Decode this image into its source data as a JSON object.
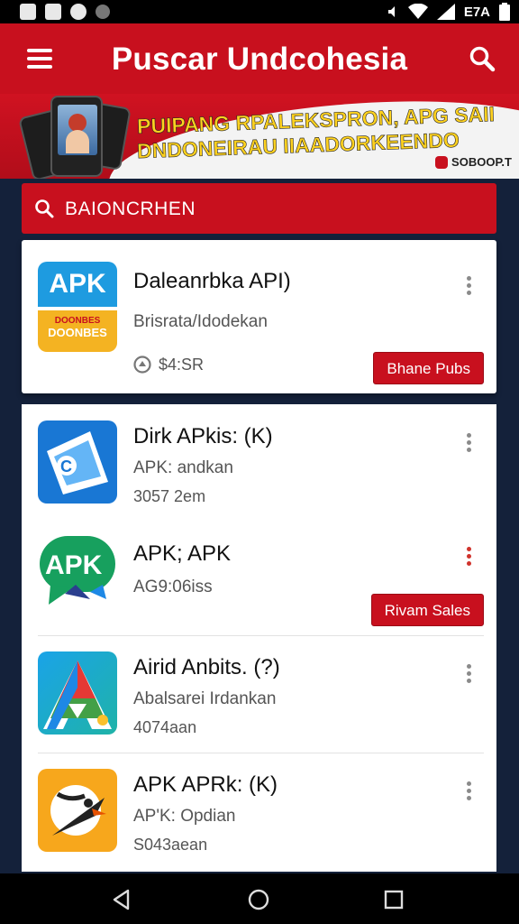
{
  "status_bar": {
    "battery_text": "E7A"
  },
  "app_bar": {
    "title": "Puscar Undcohesia"
  },
  "banner": {
    "line1": "PUIPANG RPALEKSPRON, APG SAII",
    "line2": "DNDONEIRAU IIAADORKEENDO",
    "brand": "SOBOOP.T"
  },
  "section": {
    "label": "BAIONCRHEN"
  },
  "featured": {
    "name": "Daleanrbka API)",
    "subtitle": "Brisrata/Idodekan",
    "meta": "$4:SR",
    "button": "Bhane Pubs",
    "icon_text": "APK",
    "icon_caption_1": "DOONBES",
    "icon_caption_2": "DOONBES"
  },
  "apps": [
    {
      "name": "Dirk APkis: (K)",
      "subtitle": "APK: andkan",
      "meta": "3057 2em"
    },
    {
      "name": "APK; APK",
      "subtitle": "AG9:06iss",
      "button": "Rivam Sales",
      "icon_text": "APK"
    },
    {
      "name": "Airid Anbits. (?)",
      "subtitle": "Abalsarei Irdankan",
      "meta": "4074aan"
    },
    {
      "name": "APK APRk: (K)",
      "subtitle": "AP'K: Opdian",
      "meta": "S043aean"
    }
  ],
  "icons": {
    "status": [
      "gallery-icon",
      "vpn-icon",
      "message-icon",
      "dot-icon",
      "mute-icon",
      "wifi-icon",
      "signal-icon",
      "battery-icon"
    ],
    "menu": "hamburger-icon",
    "search": "search-icon",
    "nav": [
      "back-icon",
      "home-icon",
      "recents-icon"
    ]
  },
  "colors": {
    "accent": "#c8101e",
    "background": "#14213a",
    "banner_text": "#ffd21f"
  }
}
